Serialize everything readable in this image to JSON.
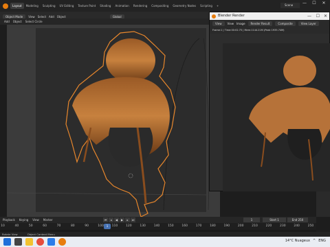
{
  "topbar": {
    "tabs": [
      "Layout",
      "Modeling",
      "Sculpting",
      "UV Editing",
      "Texture Paint",
      "Shading",
      "Animation",
      "Rendering",
      "Compositing",
      "Geometry Nodes",
      "Scripting"
    ],
    "add_tab": "+",
    "scene_label": "Scene",
    "window_controls": [
      "—",
      "☐",
      "✕"
    ]
  },
  "viewport_header": {
    "items": [
      "Object Mode",
      "View",
      "Select",
      "Add",
      "Object"
    ],
    "orientation": "Global",
    "row2": [
      "Add",
      "Object",
      "Select Circle"
    ]
  },
  "render_window": {
    "title": "Blender Render",
    "controls": [
      "—",
      "☐",
      "✕"
    ],
    "menu": [
      "View",
      "View",
      "Image",
      "Render Result",
      "Composite",
      "View Layer"
    ],
    "info": "Frame:1 | Time:00:02.75 | Mem:1144.21M (Peak 1935.74M)"
  },
  "timeline": {
    "playback_label": "Playback",
    "keying_label": "Keying",
    "view_label": "View",
    "marker_label": "Marker",
    "current_frame": "1",
    "start_label": "Start",
    "start_value": "1",
    "end_label": "End",
    "end_value": "250",
    "ticks": [
      "10",
      "40",
      "50",
      "60",
      "70",
      "80",
      "90",
      "100",
      "110",
      "120",
      "130",
      "140",
      "150",
      "160",
      "170",
      "180",
      "190",
      "200",
      "210",
      "220",
      "230",
      "240",
      "250"
    ]
  },
  "statusbar": {
    "items": [
      "Rotate View",
      "Object Context Menu"
    ]
  },
  "taskbar": {
    "weather": "14°C Nuageux",
    "tray_icons": [
      "^",
      "ENG"
    ]
  },
  "colors": {
    "accent": "#e87d0d",
    "active_tab": "#3d3d3d",
    "frame_indicator": "#4772b3",
    "hair_dark": "#6b3a16",
    "hair_light": "#c7813e"
  }
}
